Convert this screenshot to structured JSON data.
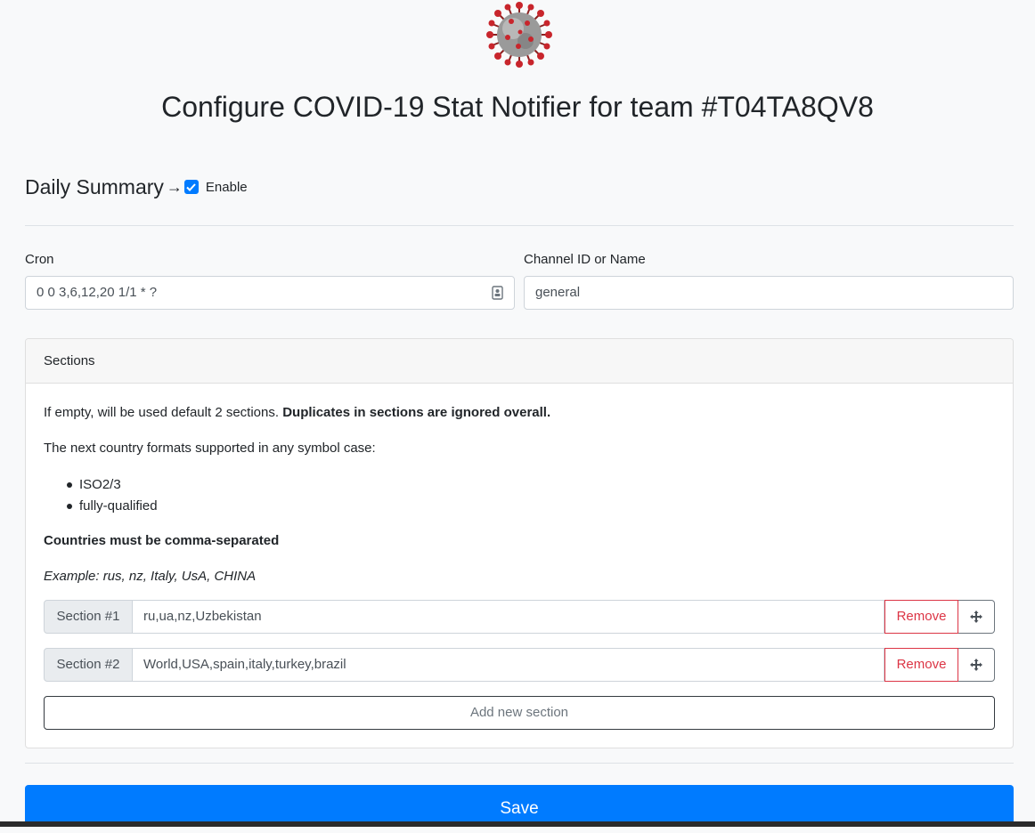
{
  "header": {
    "logo_icon": "virus-logo-icon",
    "title": "Configure COVID-19 Stat Notifier for team #T04TA8QV8"
  },
  "daily_summary": {
    "title": "Daily Summary",
    "arrow": "→",
    "enable_label": "Enable",
    "enabled": true
  },
  "cron": {
    "label": "Cron",
    "value": "0 0 3,6,12,20 1/1 * ?",
    "icon": "contact-card-icon"
  },
  "channel": {
    "label": "Channel ID or Name",
    "value": "general"
  },
  "sections_card": {
    "header": "Sections",
    "intro_text": "If empty, will be used default 2 sections. ",
    "intro_bold": "Duplicates in sections are ignored overall.",
    "formats_text": "The next country formats supported in any symbol case:",
    "formats": [
      "ISO2/3",
      "fully-qualified"
    ],
    "comma_note": "Countries must be comma-separated",
    "example": "Example: rus, nz, Italy, UsA, CHINA",
    "sections": [
      {
        "label": "Section #1",
        "value": "ru,ua,nz,Uzbekistan",
        "remove_label": "Remove"
      },
      {
        "label": "Section #2",
        "value": "World,USA,spain,italy,turkey,brazil",
        "remove_label": "Remove"
      }
    ],
    "add_label": "Add new section"
  },
  "save_label": "Save",
  "colors": {
    "primary": "#007bff",
    "danger": "#dc3545",
    "background": "#f8f9fa"
  }
}
